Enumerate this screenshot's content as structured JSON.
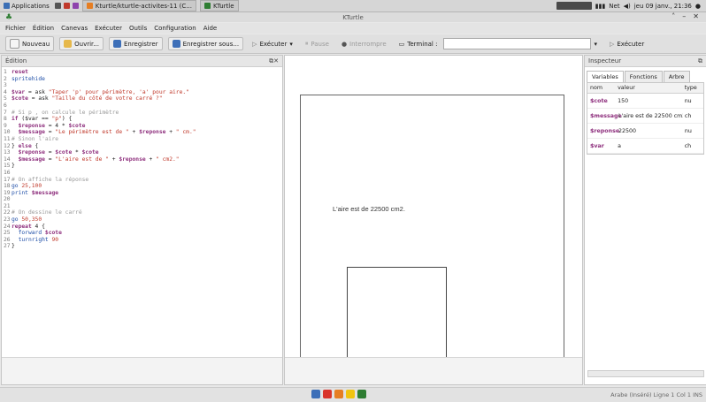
{
  "taskbar": {
    "applications_label": "Applications",
    "active_window": "Kturtle/kturtle-activites-11 (C...",
    "kturtle_task": "KTurtle",
    "clock": "jeu 09 janv., 21:36",
    "net_label": "Net"
  },
  "window": {
    "title": "KTurtle"
  },
  "menu": [
    "Fichier",
    "Édition",
    "Canevas",
    "Exécuter",
    "Outils",
    "Configuration",
    "Aide"
  ],
  "toolbar": {
    "new": "Nouveau",
    "open": "Ouvrir...",
    "save": "Enregistrer",
    "save_as": "Enregistrer sous...",
    "run": "Exécuter",
    "pause": "Pause",
    "abort": "Interrompre",
    "terminal_label": "Terminal :",
    "run_right": "Exécuter"
  },
  "editor": {
    "title": "Édition",
    "lines": [
      {
        "n": "1",
        "parts": [
          {
            "t": "reset",
            "c": "kw"
          }
        ]
      },
      {
        "n": "2",
        "parts": [
          {
            "t": "spritehide",
            "c": "cmd"
          }
        ]
      },
      {
        "n": "3",
        "parts": []
      },
      {
        "n": "4",
        "parts": [
          {
            "t": "$var",
            "c": "var"
          },
          {
            "t": " = ask ",
            "c": ""
          },
          {
            "t": "\"Taper 'p' pour périmètre, 'a' pour aire.\"",
            "c": "str"
          }
        ]
      },
      {
        "n": "5",
        "parts": [
          {
            "t": "$cote",
            "c": "var"
          },
          {
            "t": " = ask ",
            "c": ""
          },
          {
            "t": "\"Taille du côté de votre carré ?\"",
            "c": "str"
          }
        ]
      },
      {
        "n": "6",
        "parts": []
      },
      {
        "n": "7",
        "parts": [
          {
            "t": "# Si p , on calcule le périmètre",
            "c": "cmt"
          }
        ]
      },
      {
        "n": "8",
        "parts": [
          {
            "t": "if",
            "c": "kw"
          },
          {
            "t": " ($var == ",
            "c": ""
          },
          {
            "t": "\"p\"",
            "c": "str"
          },
          {
            "t": ") {",
            "c": ""
          }
        ]
      },
      {
        "n": "9",
        "parts": [
          {
            "t": "  $reponse",
            "c": "var"
          },
          {
            "t": " = 4 * ",
            "c": ""
          },
          {
            "t": "$cote",
            "c": "var"
          }
        ]
      },
      {
        "n": "10",
        "parts": [
          {
            "t": "  $message",
            "c": "var"
          },
          {
            "t": " = ",
            "c": ""
          },
          {
            "t": "\"Le périmètre est de \"",
            "c": "str"
          },
          {
            "t": " + ",
            "c": ""
          },
          {
            "t": "$reponse",
            "c": "var"
          },
          {
            "t": " + ",
            "c": ""
          },
          {
            "t": "\" cm.\"",
            "c": "str"
          }
        ]
      },
      {
        "n": "11",
        "parts": [
          {
            "t": "# Sinon l'aire",
            "c": "cmt"
          }
        ]
      },
      {
        "n": "12",
        "parts": [
          {
            "t": "} ",
            "c": ""
          },
          {
            "t": "else",
            "c": "kw"
          },
          {
            "t": " {",
            "c": ""
          }
        ]
      },
      {
        "n": "13",
        "parts": [
          {
            "t": "  $reponse",
            "c": "var"
          },
          {
            "t": " = ",
            "c": ""
          },
          {
            "t": "$cote",
            "c": "var"
          },
          {
            "t": " * ",
            "c": ""
          },
          {
            "t": "$cote",
            "c": "var"
          }
        ]
      },
      {
        "n": "14",
        "parts": [
          {
            "t": "  $message",
            "c": "var"
          },
          {
            "t": " = ",
            "c": ""
          },
          {
            "t": "\"L'aire est de \"",
            "c": "str"
          },
          {
            "t": " + ",
            "c": ""
          },
          {
            "t": "$reponse",
            "c": "var"
          },
          {
            "t": " + ",
            "c": ""
          },
          {
            "t": "\" cm2.\"",
            "c": "str"
          }
        ]
      },
      {
        "n": "15",
        "parts": [
          {
            "t": "}",
            "c": ""
          }
        ]
      },
      {
        "n": "16",
        "parts": []
      },
      {
        "n": "17",
        "parts": [
          {
            "t": "# On affiche la réponse",
            "c": "cmt"
          }
        ]
      },
      {
        "n": "18",
        "parts": [
          {
            "t": "go",
            "c": "cmd"
          },
          {
            "t": " 25,100",
            "c": "num"
          }
        ]
      },
      {
        "n": "19",
        "parts": [
          {
            "t": "print",
            "c": "cmd"
          },
          {
            "t": " ",
            "c": ""
          },
          {
            "t": "$message",
            "c": "var"
          }
        ]
      },
      {
        "n": "20",
        "parts": []
      },
      {
        "n": "21",
        "parts": []
      },
      {
        "n": "22",
        "parts": [
          {
            "t": "# On dessine le carré",
            "c": "cmt"
          }
        ]
      },
      {
        "n": "23",
        "parts": [
          {
            "t": "go",
            "c": "cmd"
          },
          {
            "t": " 50,350",
            "c": "num"
          }
        ]
      },
      {
        "n": "24",
        "parts": [
          {
            "t": "repeat",
            "c": "kw"
          },
          {
            "t": " 4 {",
            "c": ""
          }
        ]
      },
      {
        "n": "25",
        "parts": [
          {
            "t": "  forward",
            "c": "cmd"
          },
          {
            "t": " ",
            "c": ""
          },
          {
            "t": "$cote",
            "c": "var"
          }
        ]
      },
      {
        "n": "26",
        "parts": [
          {
            "t": "  turnright",
            "c": "cmd"
          },
          {
            "t": " 90",
            "c": "num"
          }
        ]
      },
      {
        "n": "27",
        "parts": [
          {
            "t": "}",
            "c": ""
          }
        ]
      }
    ]
  },
  "canvas": {
    "output_text": "L'aire est de 22500 cm2."
  },
  "inspector": {
    "title": "Inspecteur",
    "tabs": [
      "Variables",
      "Fonctions",
      "Arbre"
    ],
    "headers": [
      "nom",
      "valeur",
      "type"
    ],
    "rows": [
      {
        "name": "$cote",
        "value": "150",
        "type": "nu"
      },
      {
        "name": "$message",
        "value": "L'aire est de 22500 cm2.",
        "type": "ch"
      },
      {
        "name": "$reponse",
        "value": "22500",
        "type": "nu"
      },
      {
        "name": "$var",
        "value": "a",
        "type": "ch"
      }
    ]
  },
  "status": {
    "text": "Arabe (Inséré)   Ligne 1 Col 1   INS"
  },
  "colors": {
    "keyword": "#8e2f7d",
    "string": "#c0392b",
    "comment": "#9a9a9a",
    "command": "#1f4fa8"
  }
}
